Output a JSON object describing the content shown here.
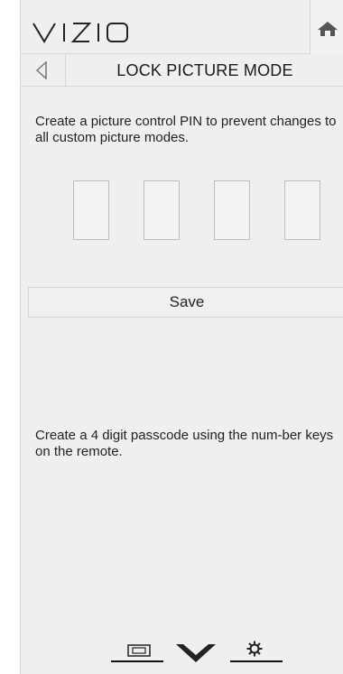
{
  "header": {
    "logo_text": "VIZIO",
    "home_icon": "home-icon"
  },
  "title_bar": {
    "back_icon": "back-arrow-icon",
    "title": "LOCK PICTURE MODE"
  },
  "content": {
    "description": "Create a picture control PIN to prevent changes to all custom picture modes.",
    "pin_fields": [
      "",
      "",
      "",
      ""
    ],
    "save_label": "Save",
    "hint": "Create a 4 digit passcode using the num-ber keys on the remote."
  },
  "footer": {
    "icons": [
      "picture-input-icon",
      "vizio-v-icon",
      "settings-gear-icon"
    ]
  }
}
